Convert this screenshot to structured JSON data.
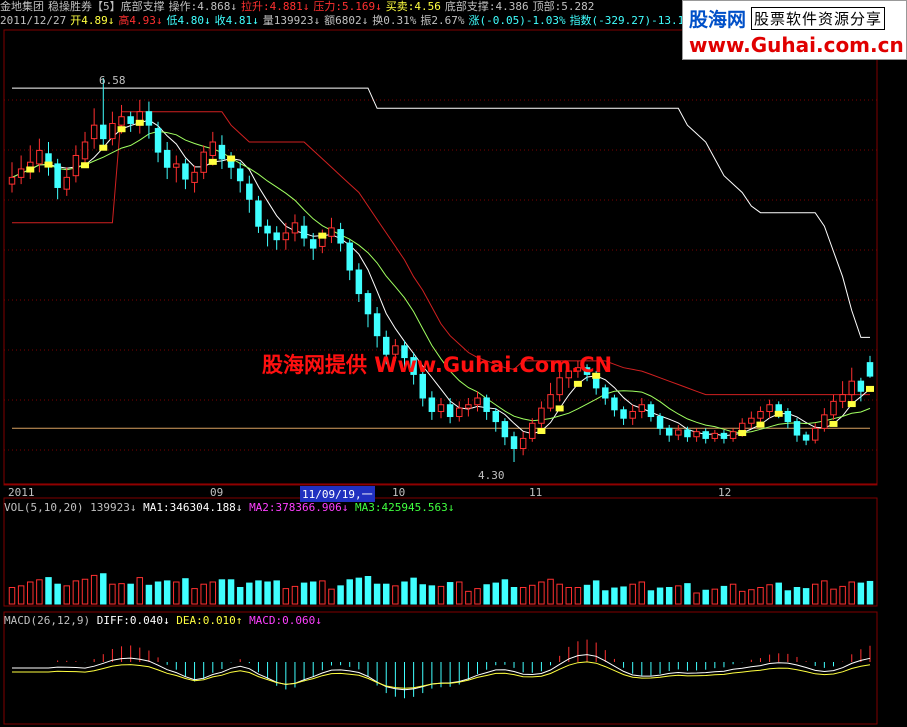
{
  "header_line1": [
    {
      "text": "金地集团",
      "color": "#c0c0c0"
    },
    {
      "text": "稳操胜券【5】底部支撑",
      "color": "#c0c0c0"
    },
    {
      "text": "操作:4.868↓",
      "color": "#c0c0c0"
    },
    {
      "text": "拉升:4.881↓",
      "color": "#ff3030"
    },
    {
      "text": "压力:5.169↓",
      "color": "#ff3030"
    },
    {
      "text": "买卖:4.56",
      "color": "#ffff40"
    },
    {
      "text": "底部支撑:4.386",
      "color": "#c0c0c0"
    },
    {
      "text": "顶部:5.282",
      "color": "#c0c0c0"
    }
  ],
  "header_line2": [
    {
      "text": "2011/12/27",
      "color": "#c0c0c0"
    },
    {
      "text": "开4.89↓",
      "color": "#ffff40"
    },
    {
      "text": "高4.93↓",
      "color": "#ff3030"
    },
    {
      "text": "低4.80↓",
      "color": "#40ffff"
    },
    {
      "text": "收4.81↓",
      "color": "#40ffff"
    },
    {
      "text": "量139923↓",
      "color": "#c0c0c0"
    },
    {
      "text": "额6802↓",
      "color": "#c0c0c0"
    },
    {
      "text": "换0.31%",
      "color": "#c0c0c0"
    },
    {
      "text": "振2.67%",
      "color": "#c0c0c0"
    },
    {
      "text": "涨(-0.05)-1.03%",
      "color": "#40ffff"
    },
    {
      "text": "指数(-329.27)-13.10%",
      "color": "#40ffff"
    }
  ],
  "logo": {
    "name": "股海网",
    "tagline": "股票软件资源分享",
    "url": "www.Guhai.com.cn"
  },
  "watermark": "股海网提供 Www.Guhai.Com.CN",
  "price_labels": {
    "high": "6.58",
    "low": "4.30"
  },
  "x_axis": [
    {
      "label": "2011",
      "selected": false
    },
    {
      "label": "09",
      "selected": false
    },
    {
      "label": "11/09/19,一",
      "selected": true
    },
    {
      "label": "10",
      "selected": false
    },
    {
      "label": "11",
      "selected": false
    },
    {
      "label": "12",
      "selected": false
    }
  ],
  "vol": {
    "title": "VOL(5,10,20)",
    "value": "139923↓",
    "ma1": "MA1:346304.188↓",
    "ma2": "MA2:378366.906↓",
    "ma3": "MA3:425945.563↓"
  },
  "macd": {
    "title": "MACD(26,12,9)",
    "diff": "DIFF:0.040↓",
    "dea": "DEA:0.010↑",
    "macd": "MACD:0.060↓"
  },
  "colors": {
    "up": "#ff3030",
    "down": "#40ffff",
    "grid": "#800000",
    "ma2": "#ff40ff",
    "ma3": "#40ff40"
  },
  "chart_data": {
    "type": "candlestick",
    "ylim": [
      4.3,
      6.58
    ],
    "candles": [
      [
        5.95,
        5.99,
        5.9,
        6.08
      ],
      [
        5.99,
        6.04,
        5.95,
        6.12
      ],
      [
        6.03,
        6.08,
        5.98,
        6.18
      ],
      [
        6.07,
        6.15,
        6.02,
        6.22
      ],
      [
        6.13,
        6.07,
        6.0,
        6.2
      ],
      [
        6.07,
        5.93,
        5.86,
        6.1
      ],
      [
        5.92,
        5.99,
        5.88,
        6.05
      ],
      [
        6.0,
        6.12,
        5.96,
        6.18
      ],
      [
        6.1,
        6.2,
        6.05,
        6.26
      ],
      [
        6.22,
        6.3,
        6.16,
        6.4
      ],
      [
        6.3,
        6.22,
        6.15,
        6.58
      ],
      [
        6.22,
        6.31,
        6.18,
        6.38
      ],
      [
        6.3,
        6.35,
        6.25,
        6.42
      ],
      [
        6.35,
        6.31,
        6.26,
        6.38
      ],
      [
        6.3,
        6.38,
        6.25,
        6.45
      ],
      [
        6.38,
        6.3,
        6.22,
        6.44
      ],
      [
        6.28,
        6.14,
        6.08,
        6.32
      ],
      [
        6.15,
        6.05,
        5.98,
        6.2
      ],
      [
        6.05,
        6.07,
        5.96,
        6.12
      ],
      [
        6.07,
        5.98,
        5.92,
        6.1
      ],
      [
        5.96,
        6.02,
        5.9,
        6.06
      ],
      [
        6.02,
        6.14,
        5.98,
        6.18
      ],
      [
        6.12,
        6.2,
        6.06,
        6.26
      ],
      [
        6.18,
        6.1,
        6.04,
        6.24
      ],
      [
        6.1,
        6.05,
        5.98,
        6.14
      ],
      [
        6.04,
        5.97,
        5.9,
        6.08
      ],
      [
        5.95,
        5.86,
        5.78,
        6.0
      ],
      [
        5.85,
        5.7,
        5.66,
        5.88
      ],
      [
        5.7,
        5.66,
        5.58,
        5.74
      ],
      [
        5.66,
        5.62,
        5.56,
        5.7
      ],
      [
        5.62,
        5.66,
        5.56,
        5.72
      ],
      [
        5.66,
        5.72,
        5.61,
        5.77
      ],
      [
        5.7,
        5.63,
        5.58,
        5.76
      ],
      [
        5.62,
        5.57,
        5.5,
        5.66
      ],
      [
        5.58,
        5.64,
        5.54,
        5.68
      ],
      [
        5.64,
        5.69,
        5.6,
        5.75
      ],
      [
        5.68,
        5.6,
        5.55,
        5.72
      ],
      [
        5.6,
        5.44,
        5.38,
        5.62
      ],
      [
        5.44,
        5.3,
        5.25,
        5.48
      ],
      [
        5.3,
        5.18,
        5.1,
        5.32
      ],
      [
        5.18,
        5.05,
        4.98,
        5.22
      ],
      [
        5.04,
        4.94,
        4.88,
        5.08
      ],
      [
        4.94,
        4.99,
        4.9,
        5.03
      ],
      [
        4.99,
        4.92,
        4.86,
        5.02
      ],
      [
        4.92,
        4.82,
        4.76,
        4.95
      ],
      [
        4.82,
        4.68,
        4.63,
        4.86
      ],
      [
        4.68,
        4.6,
        4.55,
        4.72
      ],
      [
        4.6,
        4.64,
        4.56,
        4.68
      ],
      [
        4.64,
        4.57,
        4.53,
        4.68
      ],
      [
        4.57,
        4.62,
        4.54,
        4.66
      ],
      [
        4.62,
        4.64,
        4.57,
        4.68
      ],
      [
        4.64,
        4.68,
        4.6,
        4.72
      ],
      [
        4.68,
        4.6,
        4.55,
        4.7
      ],
      [
        4.6,
        4.54,
        4.48,
        4.62
      ],
      [
        4.54,
        4.45,
        4.4,
        4.56
      ],
      [
        4.45,
        4.38,
        4.3,
        4.48
      ],
      [
        4.38,
        4.44,
        4.34,
        4.48
      ],
      [
        4.44,
        4.53,
        4.42,
        4.56
      ],
      [
        4.53,
        4.62,
        4.5,
        4.66
      ],
      [
        4.62,
        4.7,
        4.6,
        4.77
      ],
      [
        4.7,
        4.8,
        4.66,
        4.9
      ],
      [
        4.8,
        4.84,
        4.74,
        4.88
      ],
      [
        4.84,
        4.86,
        4.8,
        4.9
      ],
      [
        4.86,
        4.82,
        4.78,
        4.88
      ],
      [
        4.82,
        4.74,
        4.7,
        4.84
      ],
      [
        4.74,
        4.68,
        4.64,
        4.76
      ],
      [
        4.68,
        4.61,
        4.57,
        4.7
      ],
      [
        4.61,
        4.56,
        4.52,
        4.63
      ],
      [
        4.56,
        4.6,
        4.52,
        4.64
      ],
      [
        4.6,
        4.64,
        4.56,
        4.68
      ],
      [
        4.64,
        4.57,
        4.54,
        4.66
      ],
      [
        4.57,
        4.5,
        4.46,
        4.59
      ],
      [
        4.5,
        4.46,
        4.42,
        4.52
      ],
      [
        4.46,
        4.49,
        4.43,
        4.52
      ],
      [
        4.49,
        4.45,
        4.42,
        4.51
      ],
      [
        4.45,
        4.48,
        4.42,
        4.5
      ],
      [
        4.48,
        4.44,
        4.41,
        4.5
      ],
      [
        4.44,
        4.47,
        4.42,
        4.49
      ],
      [
        4.47,
        4.44,
        4.41,
        4.49
      ],
      [
        4.44,
        4.48,
        4.42,
        4.5
      ],
      [
        4.48,
        4.53,
        4.45,
        4.56
      ],
      [
        4.53,
        4.56,
        4.5,
        4.6
      ],
      [
        4.56,
        4.6,
        4.53,
        4.63
      ],
      [
        4.6,
        4.64,
        4.56,
        4.67
      ],
      [
        4.64,
        4.6,
        4.56,
        4.66
      ],
      [
        4.6,
        4.54,
        4.5,
        4.62
      ],
      [
        4.54,
        4.46,
        4.42,
        4.56
      ],
      [
        4.46,
        4.43,
        4.4,
        4.48
      ],
      [
        4.43,
        4.5,
        4.41,
        4.53
      ],
      [
        4.5,
        4.58,
        4.48,
        4.62
      ],
      [
        4.58,
        4.66,
        4.55,
        4.7
      ],
      [
        4.66,
        4.7,
        4.62,
        4.78
      ],
      [
        4.7,
        4.78,
        4.66,
        4.86
      ],
      [
        4.78,
        4.72,
        4.66,
        4.8
      ],
      [
        4.89,
        4.81,
        4.8,
        4.93
      ]
    ],
    "lines": {
      "pressure": [
        5.72,
        5.72,
        5.72,
        5.72,
        5.72,
        5.72,
        5.72,
        5.72,
        5.72,
        5.72,
        5.72,
        5.72,
        6.38,
        6.38,
        6.38,
        6.38,
        6.38,
        6.38,
        6.38,
        6.38,
        6.38,
        6.38,
        6.38,
        6.38,
        6.3,
        6.25,
        6.2,
        6.2,
        6.2,
        6.2,
        6.2,
        6.2,
        6.2,
        6.15,
        6.1,
        6.05,
        6.0,
        5.95,
        5.9,
        5.82,
        5.74,
        5.66,
        5.58,
        5.5,
        5.4,
        5.32,
        5.22,
        5.12,
        5.05,
        5.0,
        4.95,
        4.92,
        4.9,
        4.88,
        4.86,
        4.85,
        4.9,
        4.9,
        4.9,
        4.9,
        4.9,
        4.9,
        4.9,
        4.9,
        4.9,
        4.9,
        4.88,
        4.86,
        4.85,
        4.84,
        4.82,
        4.8,
        4.78,
        4.76,
        4.74,
        4.72,
        4.7,
        4.7,
        4.7,
        4.7,
        4.7,
        4.7,
        4.7,
        4.7,
        4.7,
        4.7,
        4.7,
        4.7,
        4.7,
        4.7,
        4.7,
        4.7,
        4.7,
        4.7,
        4.7
      ],
      "top": [
        6.52,
        6.52,
        6.52,
        6.52,
        6.52,
        6.52,
        6.52,
        6.52,
        6.52,
        6.52,
        6.52,
        6.52,
        6.52,
        6.52,
        6.52,
        6.52,
        6.52,
        6.52,
        6.52,
        6.52,
        6.52,
        6.52,
        6.52,
        6.52,
        6.52,
        6.52,
        6.52,
        6.52,
        6.52,
        6.52,
        6.52,
        6.52,
        6.52,
        6.52,
        6.52,
        6.52,
        6.52,
        6.52,
        6.52,
        6.52,
        6.4,
        6.4,
        6.4,
        6.4,
        6.4,
        6.4,
        6.4,
        6.4,
        6.4,
        6.4,
        6.4,
        6.4,
        6.4,
        6.4,
        6.4,
        6.4,
        6.4,
        6.4,
        6.4,
        6.4,
        6.4,
        6.4,
        6.4,
        6.4,
        6.4,
        6.4,
        6.4,
        6.4,
        6.4,
        6.4,
        6.4,
        6.4,
        6.4,
        6.4,
        6.3,
        6.25,
        6.2,
        6.1,
        6.0,
        5.95,
        5.9,
        5.82,
        5.78,
        5.78,
        5.78,
        5.78,
        5.78,
        5.78,
        5.78,
        5.7,
        5.55,
        5.4,
        5.2,
        5.04,
        5.04
      ],
      "support": [
        4.5,
        4.5,
        4.5,
        4.5,
        4.5,
        4.5,
        4.5,
        4.5,
        4.5,
        4.5,
        4.5,
        4.5,
        4.5,
        4.5,
        4.5,
        4.5,
        4.5,
        4.5,
        4.5,
        4.5,
        4.5,
        4.5,
        4.5,
        4.5,
        4.5,
        4.5,
        4.5,
        4.5,
        4.5,
        4.5,
        4.5,
        4.5,
        4.5,
        4.5,
        4.5,
        4.5,
        4.5,
        4.5,
        4.5,
        4.5,
        4.5,
        4.5,
        4.5,
        4.5,
        4.5,
        4.5,
        4.5,
        4.5,
        4.5,
        4.5,
        4.5,
        4.5,
        4.5,
        4.5,
        4.5,
        4.5,
        4.5,
        4.5,
        4.5,
        4.5,
        4.5,
        4.5,
        4.5,
        4.5,
        4.5,
        4.5,
        4.5,
        4.5,
        4.5,
        4.5,
        4.5,
        4.5,
        4.5,
        4.5,
        4.5,
        4.5,
        4.5,
        4.5,
        4.5,
        4.5,
        4.5,
        4.5,
        4.5,
        4.5,
        4.5,
        4.5,
        4.5,
        4.5,
        4.5,
        4.5,
        4.5,
        4.5,
        4.5,
        4.5,
        4.5
      ]
    }
  }
}
